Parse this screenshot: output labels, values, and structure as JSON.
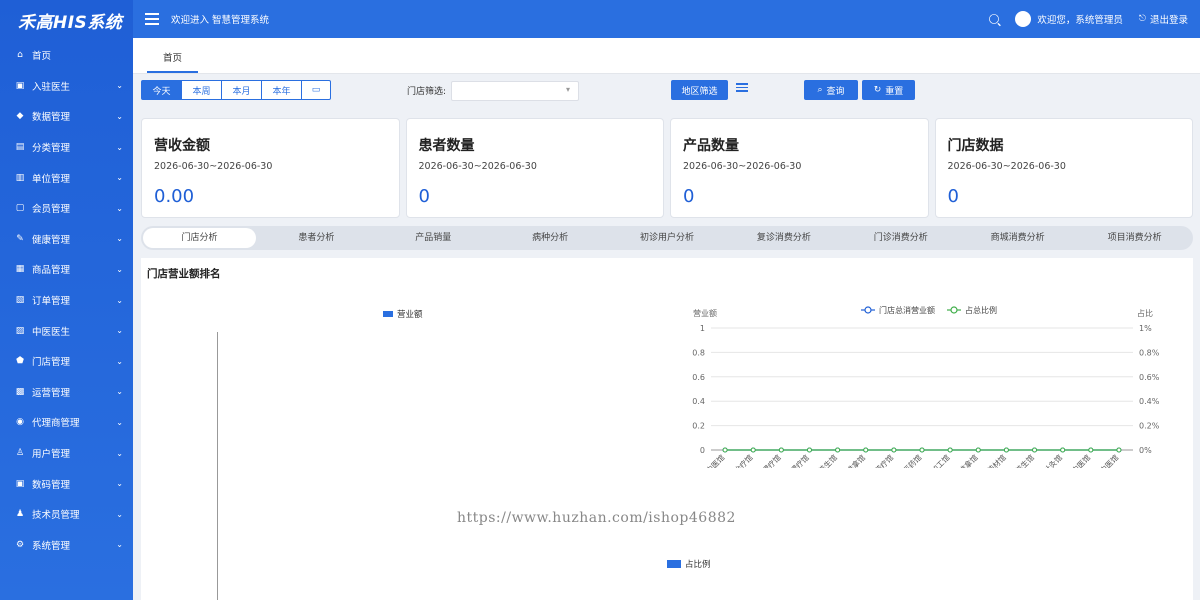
{
  "app": {
    "logo": "禾高HIS系统"
  },
  "topbar": {
    "title": "欢迎进入 智慧管理系统",
    "welcome": "欢迎您，系统管理员",
    "logout": "退出登录"
  },
  "sidebar": {
    "items": [
      {
        "label": "首页",
        "icon": "home-icon",
        "glyph": "⌂",
        "expandable": false
      },
      {
        "label": "入驻医生",
        "icon": "doctor-icon",
        "glyph": "▣",
        "expandable": true
      },
      {
        "label": "数据管理",
        "icon": "data-icon",
        "glyph": "◆",
        "expandable": true
      },
      {
        "label": "分类管理",
        "icon": "category-icon",
        "glyph": "▤",
        "expandable": true
      },
      {
        "label": "单位管理",
        "icon": "unit-icon",
        "glyph": "▥",
        "expandable": true
      },
      {
        "label": "会员管理",
        "icon": "member-icon",
        "glyph": "▢",
        "expandable": true
      },
      {
        "label": "健康管理",
        "icon": "health-icon",
        "glyph": "✎",
        "expandable": true
      },
      {
        "label": "商品管理",
        "icon": "goods-icon",
        "glyph": "▦",
        "expandable": true
      },
      {
        "label": "订单管理",
        "icon": "order-icon",
        "glyph": "▧",
        "expandable": true
      },
      {
        "label": "中医医生",
        "icon": "tcm-icon",
        "glyph": "▨",
        "expandable": true
      },
      {
        "label": "门店管理",
        "icon": "store-icon",
        "glyph": "⬟",
        "expandable": true
      },
      {
        "label": "运营管理",
        "icon": "ops-icon",
        "glyph": "▩",
        "expandable": true
      },
      {
        "label": "代理商管理",
        "icon": "agent-icon",
        "glyph": "◉",
        "expandable": true
      },
      {
        "label": "用户管理",
        "icon": "user-icon",
        "glyph": "♙",
        "expandable": true
      },
      {
        "label": "数码管理",
        "icon": "digital-icon",
        "glyph": "▣",
        "expandable": true
      },
      {
        "label": "技术员管理",
        "icon": "tech-icon",
        "glyph": "♟",
        "expandable": true
      },
      {
        "label": "系统管理",
        "icon": "settings-icon",
        "glyph": "⚙",
        "expandable": true
      }
    ]
  },
  "tabs": {
    "home": "首页"
  },
  "filter": {
    "periods": [
      "今天",
      "本周",
      "本月",
      "本年"
    ],
    "calendar_glyph": "▭",
    "store_label": "门店筛选:",
    "store_value": "",
    "region_button": "地区筛选",
    "query_button": "查询",
    "reset_button": "重置"
  },
  "cards": [
    {
      "title": "营收金额",
      "date": "2026-06-30~2026-06-30",
      "value": "0.00"
    },
    {
      "title": "患者数量",
      "date": "2026-06-30~2026-06-30",
      "value": "0"
    },
    {
      "title": "产品数量",
      "date": "2026-06-30~2026-06-30",
      "value": "0"
    },
    {
      "title": "门店数据",
      "date": "2026-06-30~2026-06-30",
      "value": "0"
    }
  ],
  "analysis_tabs": [
    "门店分析",
    "患者分析",
    "产品销量",
    "病种分析",
    "初诊用户分析",
    "复诊消费分析",
    "门诊消费分析",
    "商城消费分析",
    "项目消费分析"
  ],
  "panel": {
    "title": "门店营业额排名",
    "legend_left": "营业额",
    "legend_bottom": "占比例",
    "watermark": "https://www.huzhan.com/ishop46882"
  },
  "chart_data": {
    "type": "line",
    "ylabel": "营业额",
    "y2label": "占比",
    "ylim": [
      0,
      1
    ],
    "y2lim": [
      0,
      1
    ],
    "yticks": [
      "0",
      "0.2",
      "0.4",
      "0.6",
      "0.8",
      "1"
    ],
    "y2ticks": [
      "0%",
      "0.2%",
      "0.4%",
      "0.6%",
      "0.8%",
      "1%"
    ],
    "categories": [
      "回春中医馆",
      "治疗馆",
      "理疗馆",
      "中医理疗馆",
      "养生馆",
      "中医推拿馆",
      "中医药疗馆",
      "中医药馆",
      "加工馆",
      "推拿馆",
      "药材馆",
      "养生馆",
      "针灸馆",
      "门诊中医馆",
      "国医堂中医馆"
    ],
    "series": [
      {
        "name": "门店总消营业额",
        "axis": "left",
        "color": "#1f5fd6",
        "values": [
          0,
          0,
          0,
          0,
          0,
          0,
          0,
          0,
          0,
          0,
          0,
          0,
          0,
          0,
          0
        ]
      },
      {
        "name": "占总比例",
        "axis": "right",
        "color": "#3fae49",
        "values": [
          0,
          0,
          0,
          0,
          0,
          0,
          0,
          0,
          0,
          0,
          0,
          0,
          0,
          0,
          0
        ]
      }
    ],
    "grid": true,
    "legend": "top-center"
  }
}
